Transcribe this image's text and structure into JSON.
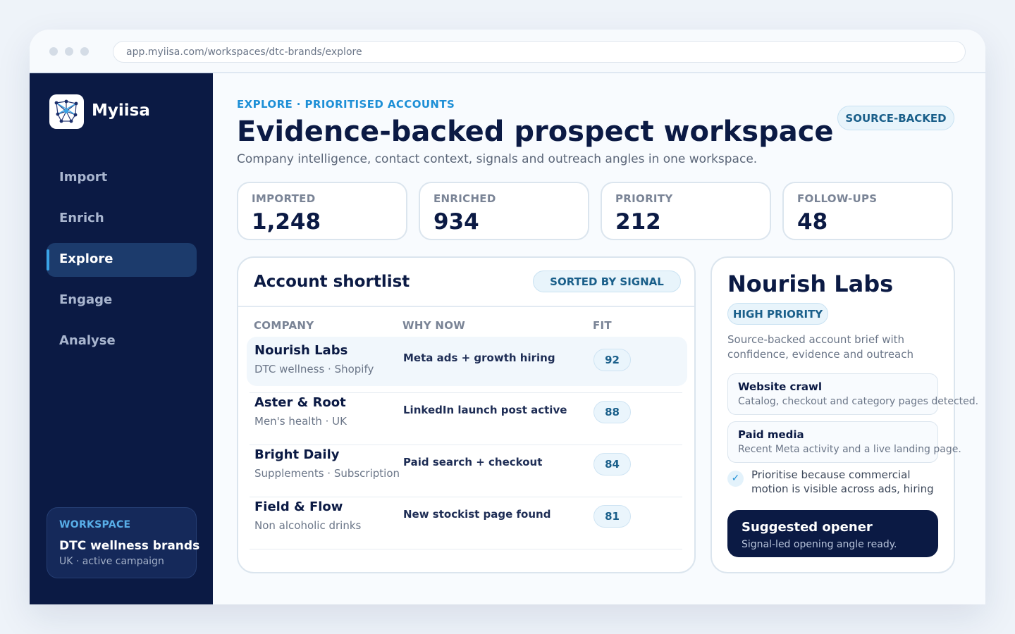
{
  "browser": {
    "url": "app.myiisa.com/workspaces/dtc-brands/explore"
  },
  "sidebar": {
    "brand": "Myiisa",
    "items": [
      {
        "label": "Import"
      },
      {
        "label": "Enrich"
      },
      {
        "label": "Explore",
        "active": true
      },
      {
        "label": "Engage"
      },
      {
        "label": "Analyse"
      }
    ],
    "workspace": {
      "label": "WORKSPACE",
      "name": "DTC wellness brands",
      "sub": "UK · active campaign"
    }
  },
  "header": {
    "eyebrow": "EXPLORE · PRIORITISED ACCOUNTS",
    "title": "Evidence-backed prospect workspace",
    "subtitle": "Company intelligence, contact context, signals and outreach angles in one workspace.",
    "badge": "SOURCE-BACKED"
  },
  "stats": [
    {
      "label": "IMPORTED",
      "value": "1,248"
    },
    {
      "label": "ENRICHED",
      "value": "934"
    },
    {
      "label": "PRIORITY",
      "value": "212"
    },
    {
      "label": "FOLLOW-UPS",
      "value": "48"
    }
  ],
  "shortlist": {
    "title": "Account shortlist",
    "sort_label": "SORTED BY SIGNAL",
    "columns": [
      "COMPANY",
      "WHY NOW",
      "FIT"
    ],
    "rows": [
      {
        "name": "Nourish Labs",
        "sub": "DTC wellness · Shopify",
        "why": "Meta ads + growth hiring",
        "fit": "92",
        "selected": true
      },
      {
        "name": "Aster & Root",
        "sub": "Men's health · UK",
        "why": "LinkedIn launch post active",
        "fit": "88"
      },
      {
        "name": "Bright Daily",
        "sub": "Supplements · Subscription",
        "why": "Paid search + checkout",
        "fit": "84"
      },
      {
        "name": "Field & Flow",
        "sub": "Non alcoholic drinks",
        "why": "New stockist page found",
        "fit": "81"
      }
    ]
  },
  "detail": {
    "title": "Nourish Labs",
    "priority": "HIGH PRIORITY",
    "description": "Source-backed account brief with confidence, evidence and outreach",
    "evidence": [
      {
        "title": "Website crawl",
        "text": "Catalog, checkout and category pages detected."
      },
      {
        "title": "Paid media",
        "text": "Recent Meta activity and a live landing page."
      }
    ],
    "reason": "Prioritise because commercial motion is visible across ads, hiring",
    "opener": {
      "title": "Suggested opener",
      "sub": "Signal-led opening angle ready."
    }
  },
  "colors": {
    "sidebar": "#0b1a44",
    "accent": "#1d8fd6",
    "active_nav": "#1c3b6c",
    "pill_bg": "#e8f4fb"
  },
  "icons": {
    "logo": "network-graph-icon",
    "check": "check-icon"
  }
}
